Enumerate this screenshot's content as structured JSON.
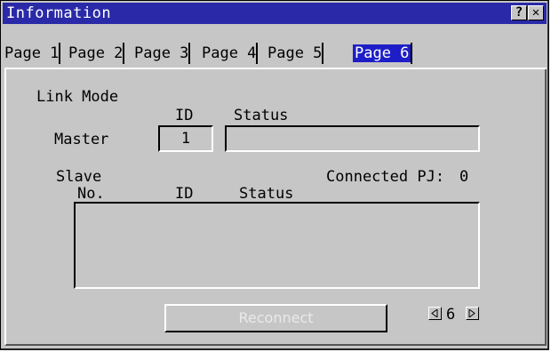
{
  "window": {
    "title": "Information",
    "help_label": "?",
    "close_label": "✕"
  },
  "tabs": [
    {
      "label": "Page 1",
      "active": false
    },
    {
      "label": "Page 2",
      "active": false
    },
    {
      "label": "Page 3",
      "active": false
    },
    {
      "label": "Page 4",
      "active": false
    },
    {
      "label": "Page 5",
      "active": false
    },
    {
      "label": "Page 6",
      "active": true
    }
  ],
  "link": {
    "heading": "Link Mode",
    "id_header": "ID",
    "status_header": "Status",
    "master_label": "Master",
    "master_id": "1",
    "master_status": "",
    "slave_label": "Slave",
    "connected_label": "Connected PJ:",
    "connected_count": "0",
    "no_header": "No.",
    "slave_id_header": "ID",
    "slave_status_header": "Status",
    "slaves": []
  },
  "actions": {
    "reconnect_label": "Reconnect"
  },
  "pager": {
    "current": "6"
  },
  "colors": {
    "titlebar": "#2a2aa8",
    "tab_active": "#1e1ec8",
    "background": "#c6c6c6"
  }
}
